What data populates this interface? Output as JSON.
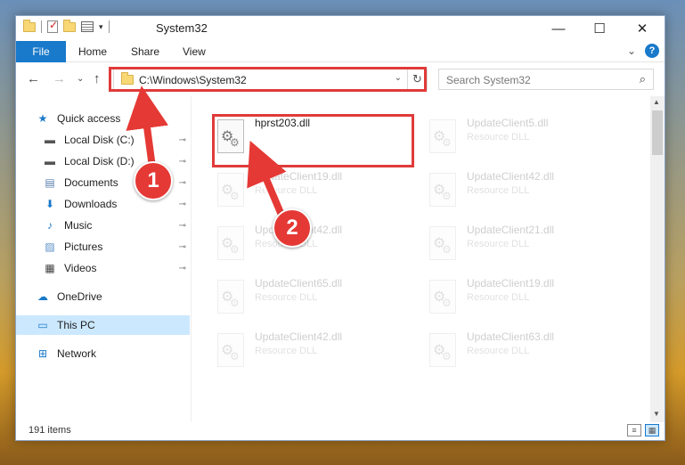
{
  "window": {
    "title": "System32",
    "controls": {
      "minimize": "—",
      "maximize": "☐",
      "close": "✕"
    }
  },
  "ribbon": {
    "tabs": [
      {
        "label": "File"
      },
      {
        "label": "Home"
      },
      {
        "label": "Share"
      },
      {
        "label": "View"
      }
    ],
    "expand_glyph": "⌄",
    "help_glyph": "?"
  },
  "nav": {
    "back": "←",
    "forward": "→",
    "recent": "⌄",
    "up": "↑",
    "address": "C:\\Windows\\System32",
    "refresh": "↻",
    "search_placeholder": "Search System32",
    "search_glyph": "⌕"
  },
  "sidebar": {
    "items": [
      {
        "label": "Quick access",
        "icon": "star-icon",
        "glyph": "★",
        "color": "#1979ca"
      },
      {
        "label": "Local Disk (C:)",
        "icon": "drive-icon",
        "glyph": "▬",
        "color": "#555555",
        "pinned": true
      },
      {
        "label": "Local Disk (D:)",
        "icon": "drive-icon",
        "glyph": "▬",
        "color": "#555555",
        "pinned": true
      },
      {
        "label": "Documents",
        "icon": "documents-icon",
        "glyph": "▤",
        "color": "#5a7fae",
        "pinned": true
      },
      {
        "label": "Downloads",
        "icon": "downloads-icon",
        "glyph": "⬇",
        "color": "#1979ca",
        "pinned": true
      },
      {
        "label": "Music",
        "icon": "music-icon",
        "glyph": "♪",
        "color": "#1979ca",
        "pinned": true
      },
      {
        "label": "Pictures",
        "icon": "pictures-icon",
        "glyph": "▨",
        "color": "#5a8fc8",
        "pinned": true
      },
      {
        "label": "Videos",
        "icon": "videos-icon",
        "glyph": "▦",
        "color": "#444444",
        "pinned": true
      },
      {
        "label": "OneDrive",
        "icon": "cloud-icon",
        "glyph": "☁",
        "color": "#1979ca"
      },
      {
        "label": "This PC",
        "icon": "computer-icon",
        "glyph": "▭",
        "color": "#1979ca",
        "selected": true
      },
      {
        "label": "Network",
        "icon": "network-icon",
        "glyph": "⊞",
        "color": "#1979ca"
      }
    ],
    "pin_glyph": "📌"
  },
  "files": [
    {
      "name": "hprst203.dll",
      "type": "",
      "highlighted": true
    },
    {
      "name": "UpdateClient5.dll",
      "type": "Resource DLL"
    },
    {
      "name": "UpdateClient19.dll",
      "type": "Resource DLL"
    },
    {
      "name": "UpdateClient42.dll",
      "type": "Resource DLL"
    },
    {
      "name": "UpdateClient42.dll",
      "type": "Resource DLL"
    },
    {
      "name": "UpdateClient21.dll",
      "type": "Resource DLL"
    },
    {
      "name": "UpdateClient65.dll",
      "type": "Resource DLL"
    },
    {
      "name": "UpdateClient19.dll",
      "type": "Resource DLL"
    },
    {
      "name": "UpdateClient42.dll",
      "type": "Resource DLL"
    },
    {
      "name": "UpdateClient63.dll",
      "type": "Resource DLL"
    }
  ],
  "status": {
    "item_count": "191 items"
  },
  "callouts": [
    {
      "label": "1"
    },
    {
      "label": "2"
    }
  ],
  "colors": {
    "accent": "#1979ca",
    "highlight": "#e03a3a",
    "selection": "#cce8ff"
  }
}
